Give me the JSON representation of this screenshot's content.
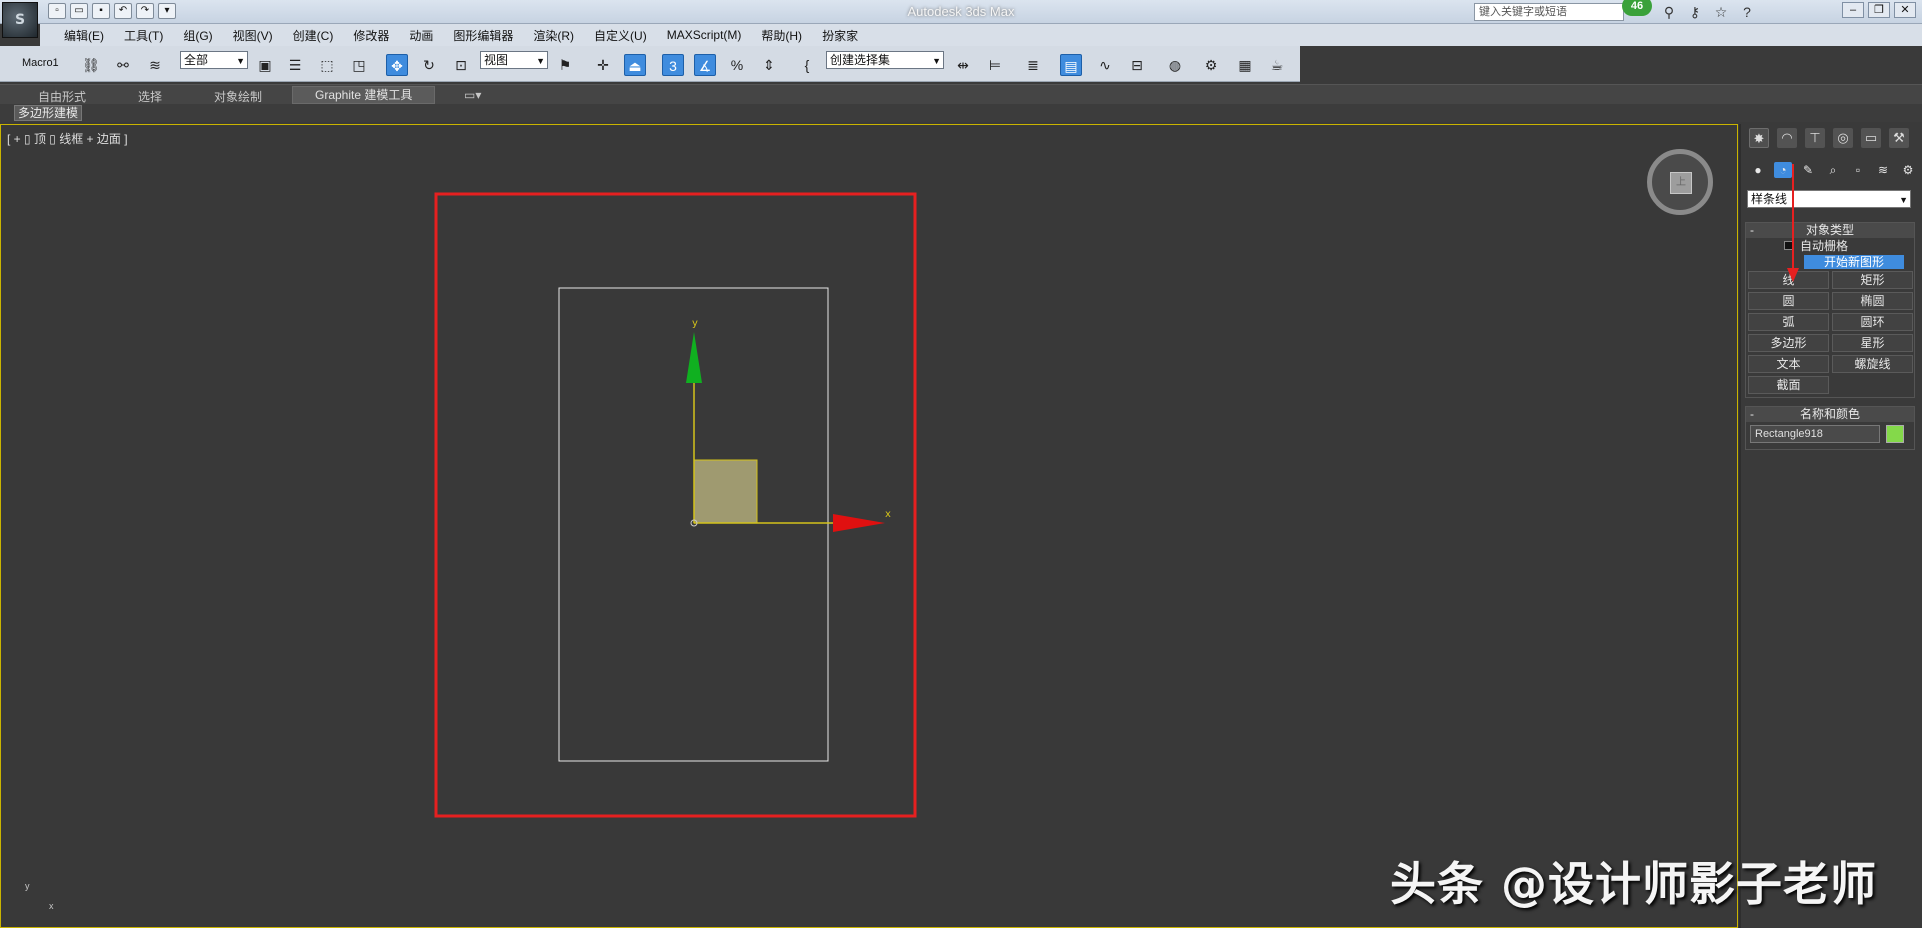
{
  "window": {
    "app_logo": "S",
    "title": "Autodesk 3ds Max",
    "search_placeholder": "键入关键字或短语",
    "badge_count": "46"
  },
  "menu": [
    "编辑(E)",
    "工具(T)",
    "组(G)",
    "视图(V)",
    "创建(C)",
    "修改器",
    "动画",
    "图形编辑器",
    "渲染(R)",
    "自定义(U)",
    "MAXScript(M)",
    "帮助(H)",
    "扮家家"
  ],
  "toolbar": {
    "macro_label": "Macro1",
    "filter_dropdown": "全部",
    "coord_dropdown": "视图",
    "snap_value": "3",
    "selection_set": "创建选择集"
  },
  "ribbon": {
    "tabs": [
      "自由形式",
      "选择",
      "对象绘制",
      "Graphite 建模工具"
    ],
    "active_tab": "Graphite 建模工具",
    "sub_panel": "多边形建模"
  },
  "viewport": {
    "label": "[ + ▯ 顶 ▯ 线框 + 边面 ]",
    "axis_x": "x",
    "axis_y": "y",
    "viewcube_face": "上",
    "corner_axis_y": "y",
    "corner_axis_x": "x"
  },
  "command_panel": {
    "category_dropdown": "样条线",
    "object_type_header": "对象类型",
    "auto_grid_label": "自动栅格",
    "start_new_shape": "开始新图形",
    "buttons": [
      "线",
      "矩形",
      "圆",
      "椭圆",
      "弧",
      "圆环",
      "多边形",
      "星形",
      "文本",
      "螺旋线",
      "截面",
      ""
    ],
    "name_color_header": "名称和颜色",
    "object_name": "Rectangle918",
    "object_color": "#84d94a"
  },
  "watermark": "头条 @设计师影子老师",
  "colors": {
    "accent_blue": "#3f8cde",
    "annotation_red": "#e62020",
    "gizmo_x": "#e01010",
    "gizmo_y": "#10b020",
    "gizmo_axis_line": "#d4c31a",
    "selected_shape_fill": "#9f9a70"
  }
}
